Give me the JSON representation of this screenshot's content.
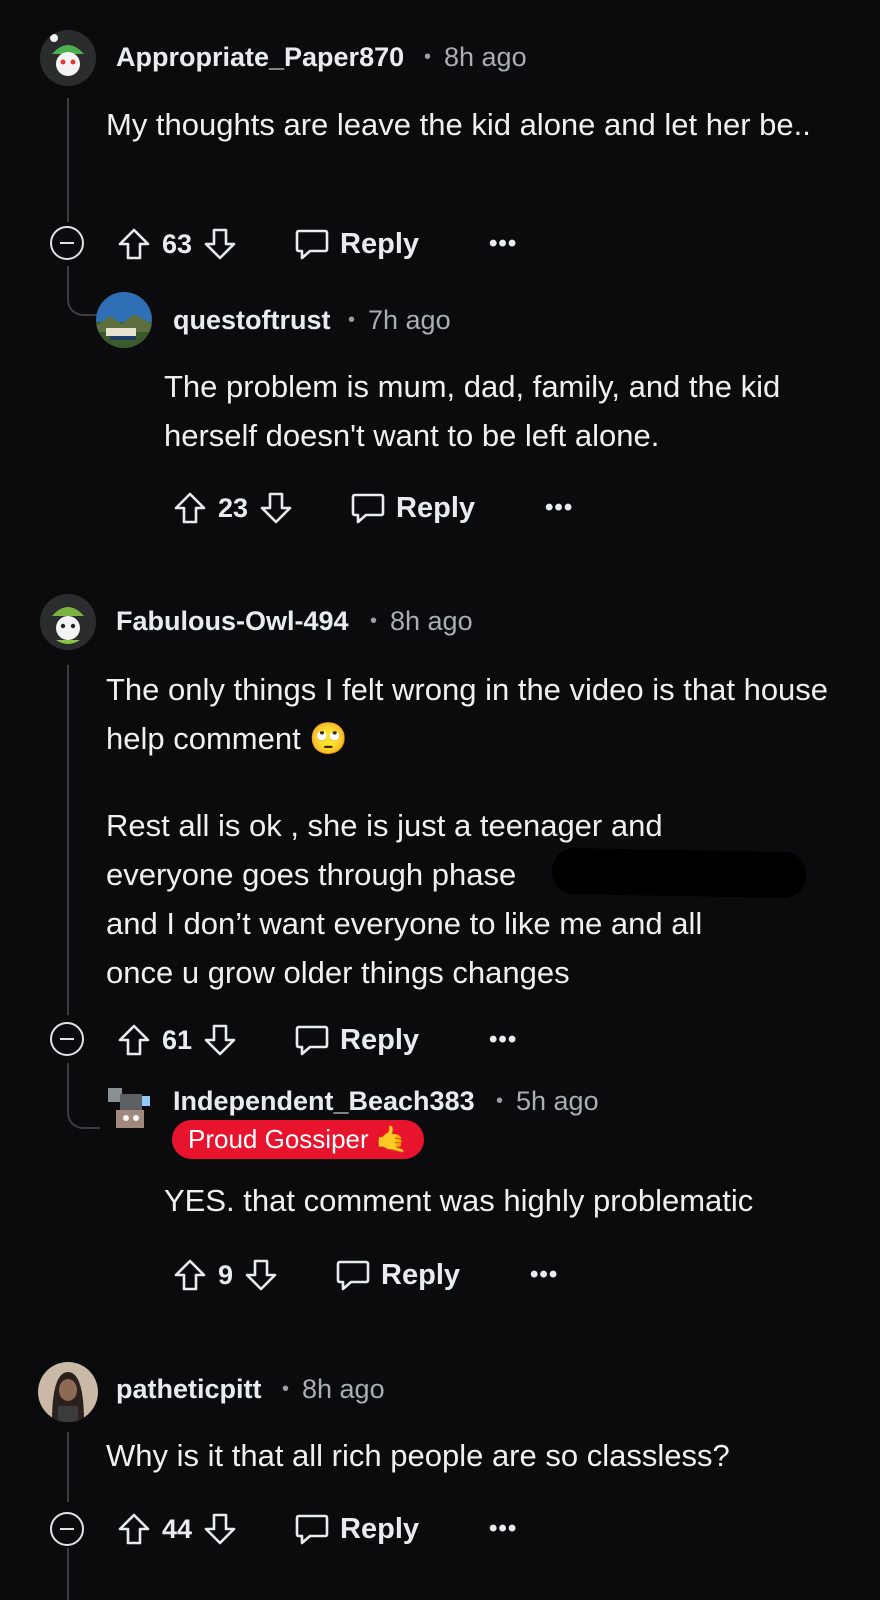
{
  "comments": [
    {
      "username": "Appropriate_Paper870",
      "time": "8h ago",
      "body": "My thoughts are leave the kid alone and let her be..",
      "votes": "63",
      "reply_label": "Reply",
      "avatar_icon": "snoo-avatar-icon"
    },
    {
      "username": "questoftrust",
      "time": "7h ago",
      "body": "The problem is mum, dad, family, and the kid herself doesn't want to be left alone.",
      "votes": "23",
      "reply_label": "Reply",
      "avatar_icon": "landscape-avatar-icon"
    },
    {
      "username": "Fabulous-Owl-494",
      "time": "8h ago",
      "body_p1": "The only things I felt wrong in the video is that house help comment 🙄",
      "body_p2_line1": "Rest all is ok , she is just a teenager and",
      "body_p2_line2": "everyone goes through phase ",
      "body_p2_line3": "and I don’t want everyone to like me and all",
      "body_p2_line4": "once u grow older things changes",
      "votes": "61",
      "reply_label": "Reply",
      "avatar_icon": "snoo-avatar-icon"
    },
    {
      "username": "Independent_Beach383",
      "time": "5h ago",
      "flair": "Proud Gossiper 🤙",
      "body": "YES. that comment was highly problematic",
      "votes": "9",
      "reply_label": "Reply",
      "avatar_icon": "robot-avatar-icon"
    },
    {
      "username": "patheticpitt",
      "time": "8h ago",
      "body": "Why is it that all rich people are so classless?",
      "votes": "44",
      "reply_label": "Reply",
      "avatar_icon": "photo-avatar-icon"
    }
  ],
  "more_label": "•••",
  "separator": "•",
  "colors": {
    "background": "#0b0b0d",
    "text": "#e9ecee",
    "flair": "#e8142d",
    "thread_line": "#3a3d40"
  }
}
